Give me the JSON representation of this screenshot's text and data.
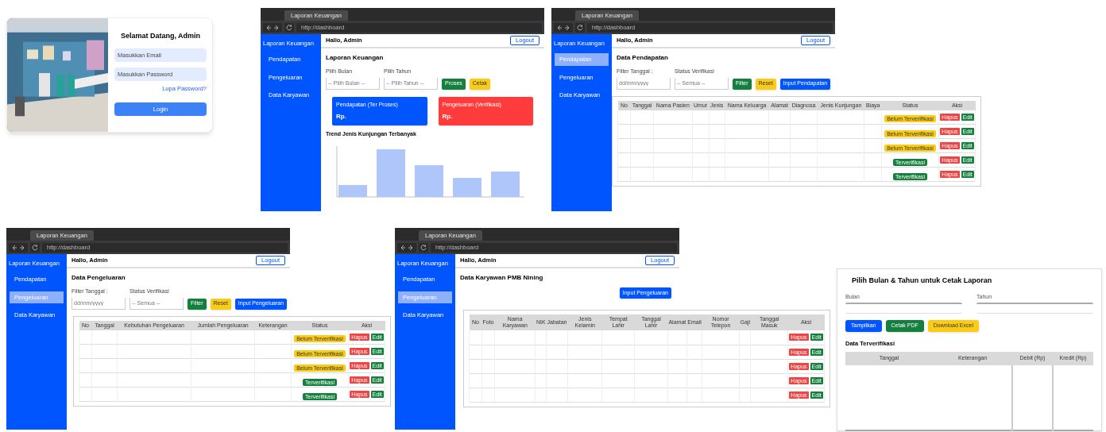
{
  "login": {
    "title": "Selamat Datang, Admin",
    "fields": [
      {
        "placeholder": "Masukkan Email"
      },
      {
        "placeholder": "Masukkan Password"
      }
    ],
    "link": "Lupa Password?",
    "button": "Login"
  },
  "screens": [
    {
      "kind": "dashboard",
      "tab": "Laporan Keuangan",
      "url": "http://dashboard",
      "brand": "Laporan Keuangan",
      "nav": [
        {
          "label": "Pendapatan",
          "selected": false
        },
        {
          "label": "Pengeluaran",
          "selected": false
        },
        {
          "label": "Data Karyawan",
          "selected": false
        }
      ],
      "greeting": "Hallo, Admin",
      "logout": "Logout",
      "title": "Laporan Keuangan",
      "filters": [
        {
          "label": "Pilih Bulan",
          "placeholder": "-- Pilih Bulan --"
        },
        {
          "label": "Pilih Tahun",
          "placeholder": "-- Pilih Tahun --"
        }
      ],
      "buttons": [
        {
          "label": "Proses",
          "color": "#15803d"
        },
        {
          "label": "Cetak",
          "color": "#facc15"
        }
      ],
      "cards": [
        {
          "title": "Pendapatan (Ter Proses)",
          "value": "Rp.",
          "color": "#0055ff"
        },
        {
          "title": "Pengeluaran (Verifikasi)",
          "value": "Rp.",
          "color": "#ff3b3b"
        }
      ],
      "chart_title": "Trend Jenis Kunjungan Terbanyak"
    },
    {
      "kind": "table",
      "tab": "Laporan Keuangan",
      "url": "http://dashboard",
      "brand": "Laporan Keuangan",
      "nav": [
        {
          "label": "Pendapatan",
          "selected": true
        },
        {
          "label": "Pengeluaran",
          "selected": false
        },
        {
          "label": "Data Karyawan",
          "selected": false
        }
      ],
      "greeting": "Hallo, Admin",
      "logout": "Logout",
      "title": "Data Pendapatan",
      "filters": [
        {
          "label": "Filter Tanggal :",
          "placeholder": "dd/mm/yyyy"
        },
        {
          "label": "Status Verifikasi",
          "placeholder": "-- Semua --"
        }
      ],
      "buttons": [
        {
          "label": "Filter",
          "color": "#15803d"
        },
        {
          "label": "Reset",
          "color": "#facc15"
        },
        {
          "label": "Input Pendapatan",
          "color": "#0055ff"
        }
      ],
      "table": {
        "columns": [
          "No",
          "Tanggal",
          "Nama Pasien",
          "Umur",
          "Jenis",
          "Nama Keluarga",
          "Alamat",
          "Diagnosa",
          "Jenis Kunjungan",
          "Biaya",
          "Status",
          "Aksi"
        ],
        "rows": [
          {
            "status": "Belum Terverifikasi",
            "verified": false,
            "delete": "Hapus",
            "edit": "Edit"
          },
          {
            "status": "Belum Terverifikasi",
            "verified": false,
            "delete": "Hapus",
            "edit": "Edit"
          },
          {
            "status": "Belum Terverifikasi",
            "verified": false,
            "delete": "Hapus",
            "edit": "Edit"
          },
          {
            "status": "Terverifikasi",
            "verified": true,
            "delete": "Hapus",
            "edit": "Edit"
          },
          {
            "status": "Terverifikasi",
            "verified": true,
            "delete": "Hapus",
            "edit": "Edit"
          }
        ]
      }
    },
    {
      "kind": "table",
      "tab": "Laporan Keuangan",
      "url": "http://dashboard",
      "brand": "Laporan Keuangan",
      "nav": [
        {
          "label": "Pendapatan",
          "selected": false
        },
        {
          "label": "Pengeluaran",
          "selected": true
        },
        {
          "label": "Data Karyawan",
          "selected": false
        }
      ],
      "greeting": "Hallo, Admin",
      "logout": "Logout",
      "title": "Data Pengeluaran",
      "filters": [
        {
          "label": "Filter Tanggal :",
          "placeholder": "dd/mm/yyyy"
        },
        {
          "label": "Status Verifikasi",
          "placeholder": "-- Semua --"
        }
      ],
      "buttons": [
        {
          "label": "Filter",
          "color": "#15803d"
        },
        {
          "label": "Reset",
          "color": "#facc15"
        },
        {
          "label": "Input Pengeluaran",
          "color": "#0055ff"
        }
      ],
      "table": {
        "columns": [
          "No",
          "Tanggal",
          "Kebutuhan Pengeluaran",
          "Jumlah Pengeluaran",
          "Keterangan",
          "Status",
          "Aksi"
        ],
        "rows": [
          {
            "status": "Belum Terverifikasi",
            "verified": false,
            "delete": "Hapus",
            "edit": "Edit"
          },
          {
            "status": "Belum Terverifikasi",
            "verified": false,
            "delete": "Hapus",
            "edit": "Edit"
          },
          {
            "status": "Belum Terverifikasi",
            "verified": false,
            "delete": "Hapus",
            "edit": "Edit"
          },
          {
            "status": "Terverifikasi",
            "verified": true,
            "delete": "Hapus",
            "edit": "Edit"
          },
          {
            "status": "Terverifikasi",
            "verified": true,
            "delete": "Hapus",
            "edit": "Edit"
          }
        ]
      }
    },
    {
      "kind": "table",
      "tab": "Laporan Keuangan",
      "url": "http://dashboard",
      "brand": "Laporan Keuangan",
      "nav": [
        {
          "label": "Pendapatan",
          "selected": false
        },
        {
          "label": "Pengeluaran",
          "selected": true
        },
        {
          "label": "Data Karyawan",
          "selected": false
        }
      ],
      "greeting": "Hallo, Admin",
      "logout": "Logout",
      "title": "Data Karyawan PMB Nining",
      "buttons": [
        {
          "label": "Input Pengeluaran",
          "color": "#0055ff"
        }
      ],
      "table": {
        "columns": [
          "No",
          "Foto",
          "Nama Karyawan",
          "NIK",
          "Jabatan",
          "Jenis Kelamin",
          "Tempat Lahir",
          "Tanggal Lahir",
          "Alamat",
          "Email",
          "Nomor Telepon",
          "Gaji",
          "Tanggal Masuk",
          "Aksi"
        ],
        "rows": [
          {
            "delete": "Hapus",
            "edit": "Edit"
          },
          {
            "delete": "Hapus",
            "edit": "Edit"
          },
          {
            "delete": "Hapus",
            "edit": "Edit"
          },
          {
            "delete": "Hapus",
            "edit": "Edit"
          },
          {
            "delete": "Hapus",
            "edit": "Edit"
          }
        ]
      }
    }
  ],
  "report": {
    "title": "Pilih Bulan & Tahun untuk Cetak Laporan",
    "fields": [
      {
        "label": "Bulan"
      },
      {
        "label": "Tahun"
      }
    ],
    "buttons": [
      {
        "label": "Tampilkan",
        "color": "#0055ff"
      },
      {
        "label": "Cetak PDF",
        "color": "#15803d"
      },
      {
        "label": "Download Excel",
        "color": "#facc15"
      }
    ],
    "section": "Data Terverifikasi",
    "columns": [
      "Tanggal",
      "Keterangan",
      "Debit (Rp)",
      "Kredit (Rp)"
    ]
  }
}
